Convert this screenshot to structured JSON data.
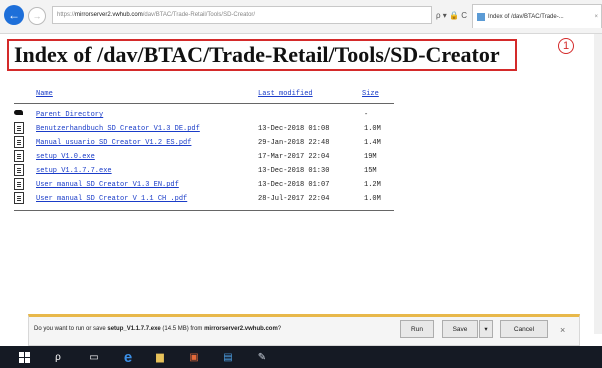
{
  "browser": {
    "address_prefix": "https://",
    "address_host": "mirrorserver2.vwhub.com",
    "address_path": "/dav/BTAC/Trade-Retail/Tools/SD-Creator/",
    "address_icons": "ρ ▾ 🔒 C",
    "tab_title": "Index of /dav/BTAC/Trade-...",
    "back_icon": "←"
  },
  "page": {
    "title": "Index of /dav/BTAC/Trade-Retail/Tools/SD-Creator",
    "annotation_number": "1"
  },
  "listing": {
    "columns": {
      "name": "Name",
      "modified": "Last modified",
      "size": "Size"
    },
    "rows": [
      {
        "name": "Parent Directory",
        "modified": "",
        "size": "-",
        "icon": "parent-directory-icon"
      },
      {
        "name": "Benutzerhandbuch SD Creator V1.3 DE.pdf",
        "modified": "13-Dec-2018 01:08",
        "size": "1.0M",
        "icon": "file-icon"
      },
      {
        "name": "Manual usuario SD Creator V1.2 ES.pdf",
        "modified": "29-Jan-2018 22:48",
        "size": "1.4M",
        "icon": "file-icon"
      },
      {
        "name": "setup V1.0.exe",
        "modified": "17-Mar-2017 22:04",
        "size": "19M",
        "icon": "file-icon"
      },
      {
        "name": "setup V1.1.7.7.exe",
        "modified": "13-Dec-2018 01:30",
        "size": "15M",
        "icon": "file-icon"
      },
      {
        "name": "User manual SD Creator V1.3 EN.pdf",
        "modified": "13-Dec-2018 01:07",
        "size": "1.2M",
        "icon": "file-icon"
      },
      {
        "name": "User manual SD Creator V 1.1 CH .pdf",
        "modified": "28-Jul-2017 22:04",
        "size": "1.0M",
        "icon": "file-icon"
      }
    ]
  },
  "download_bar": {
    "text_before": "Do you want to run or save ",
    "file_name": "setup_V1.1.7.7.exe",
    "text_middle": " (14.5 MB) from ",
    "server": "mirrorserver2.vwhub.com",
    "text_after": "?",
    "run_label": "Run",
    "save_label": "Save",
    "save_menu_label": "▾",
    "cancel_label": "Cancel",
    "close_label": "×",
    "accent_color": "#e8b84a"
  },
  "taskbar": {
    "icons": [
      "windows-start",
      "search",
      "task-view",
      "edge",
      "file-explorer",
      "media-player",
      "store",
      "app"
    ]
  }
}
